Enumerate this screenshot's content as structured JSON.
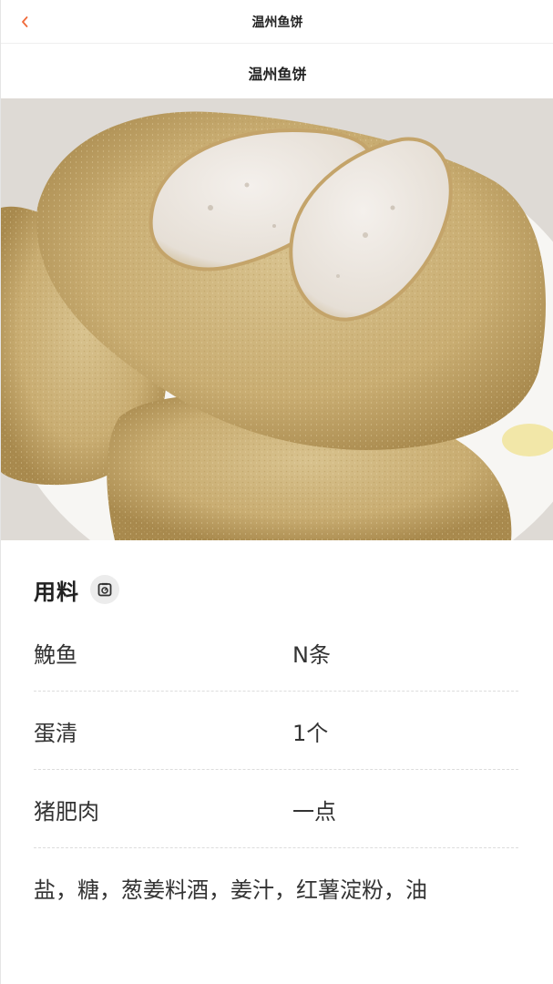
{
  "nav": {
    "title": "温州鱼饼",
    "back_icon": "chevron-left-icon",
    "accent_color": "#f06a3a"
  },
  "recipe": {
    "title": "温州鱼饼",
    "photo": "fish-cake-photo"
  },
  "ingredients": {
    "heading": "用料",
    "scale_icon": "kitchen-scale-icon",
    "items": [
      {
        "name": "鮸鱼",
        "amount": "N条"
      },
      {
        "name": "蛋清",
        "amount": "1个"
      },
      {
        "name": "猪肥肉",
        "amount": "一点"
      }
    ],
    "other": "盐，糖，葱姜料酒，姜汁，红薯淀粉，油"
  }
}
